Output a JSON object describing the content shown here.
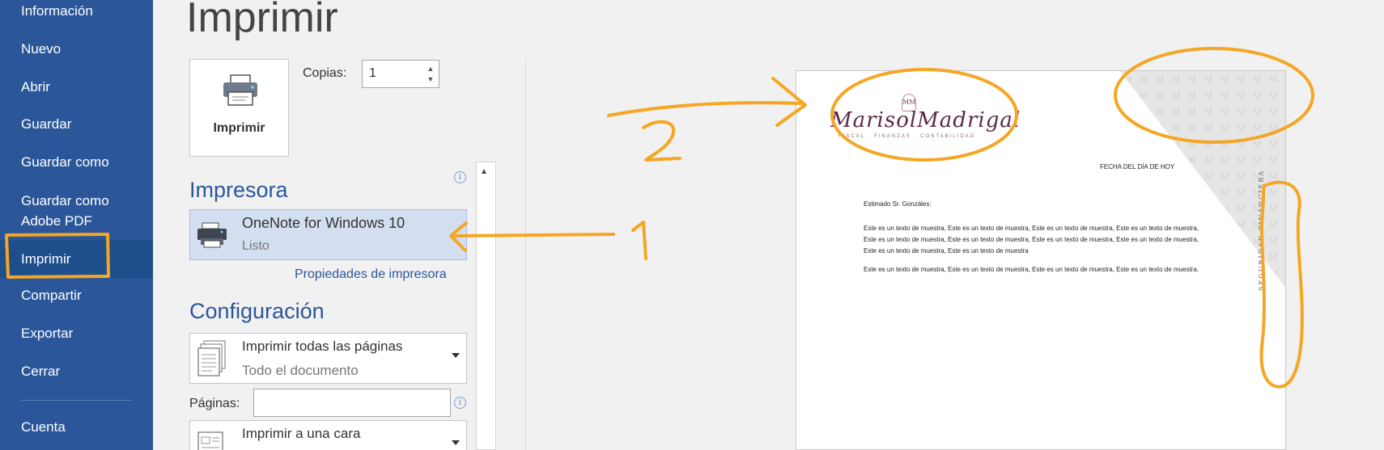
{
  "sidebar": {
    "items": [
      {
        "label": "Información"
      },
      {
        "label": "Nuevo"
      },
      {
        "label": "Abrir"
      },
      {
        "label": "Guardar"
      },
      {
        "label": "Guardar como"
      },
      {
        "label": "Guardar como",
        "label2": "Adobe PDF"
      },
      {
        "label": "Imprimir",
        "active": true
      },
      {
        "label": "Compartir"
      },
      {
        "label": "Exportar"
      },
      {
        "label": "Cerrar"
      },
      {
        "label": "Cuenta"
      }
    ]
  },
  "main": {
    "title": "Imprimir",
    "print_button_label": "Imprimir",
    "copies_label": "Copias:",
    "copies_value": "1",
    "printer_section": "Impresora",
    "printer_name": "OneNote for Windows 10",
    "printer_status": "Listo",
    "printer_properties_link": "Propiedades de impresora",
    "settings_section": "Configuración",
    "print_range_main": "Imprimir todas las páginas",
    "print_range_sub": "Todo el documento",
    "pages_label": "Páginas:",
    "pages_value": "",
    "sides_main": "Imprimir a una cara",
    "info_glyph": "i"
  },
  "preview": {
    "logo_monogram": "MM",
    "logo_name": "MarisolMadrigal",
    "logo_tagline": "FISCAL · FINANZAS · CONTABILIDAD",
    "date_text": "FECHA DEL DÍA DE HOY",
    "greeting": "Estimado Sr. Gonzáles:",
    "paragraph1": "Este es un texto de muestra, Este es un texto de muestra, Este es un texto de muestra, Este es un texto de muestra, Este es un texto de muestra, Este es un texto de muestra, Este es un texto de muestra, Este es un texto de muestra, Este es un texto de muestra, Este es un texto de muestra",
    "paragraph2": "Este es un texto de muestra, Este es un texto de muestra, Este es un texto de muestra, Este es un texto de muestra.",
    "vertical_text": "SEGURIDAD FINANCIERA"
  },
  "annotations": {
    "label_1": "1",
    "label_2": "2",
    "color": "#f5a623"
  },
  "colors": {
    "sidebar": "#2b579a",
    "accent": "#2b579a",
    "selected_card": "#d3dff0"
  }
}
